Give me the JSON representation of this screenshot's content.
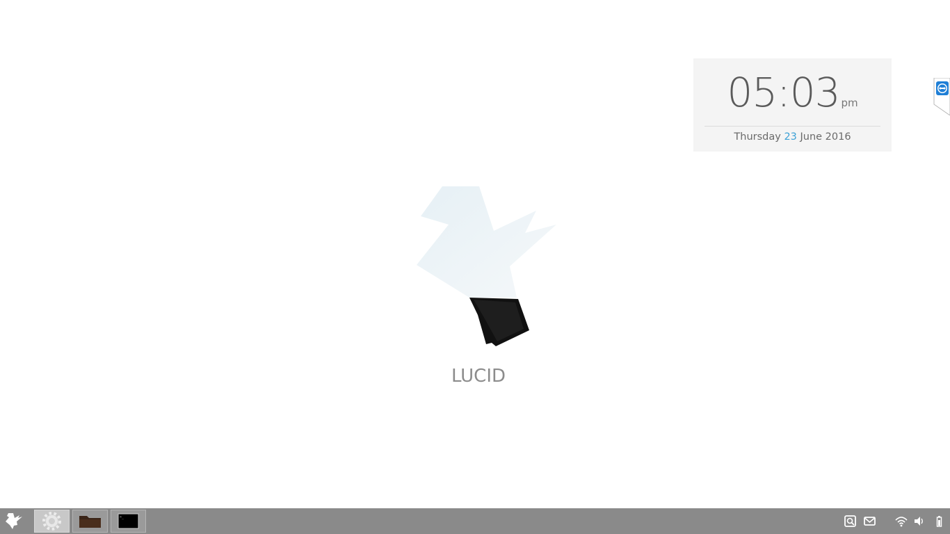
{
  "clock": {
    "time": "05:03",
    "ampm": "pm",
    "weekday": "Thursday",
    "day": "23",
    "month_year": "June 2016"
  },
  "branding": {
    "label": "LUCID"
  },
  "taskbar": {
    "start_icon": "lucid-bird-icon",
    "tasks": [
      {
        "icon": "settings-gear-icon",
        "active": true
      },
      {
        "icon": "folder-icon",
        "active": false
      },
      {
        "icon": "terminal-icon",
        "active": false
      }
    ],
    "tray": [
      "screenshot-icon",
      "mail-icon",
      "wifi-icon",
      "volume-icon",
      "battery-icon"
    ]
  },
  "edge_tab": {
    "icon": "teamviewer-icon"
  },
  "colors": {
    "taskbar_bg": "#8a8a8a",
    "accent": "#3da1d6",
    "widget_bg": "#f4f4f4"
  }
}
